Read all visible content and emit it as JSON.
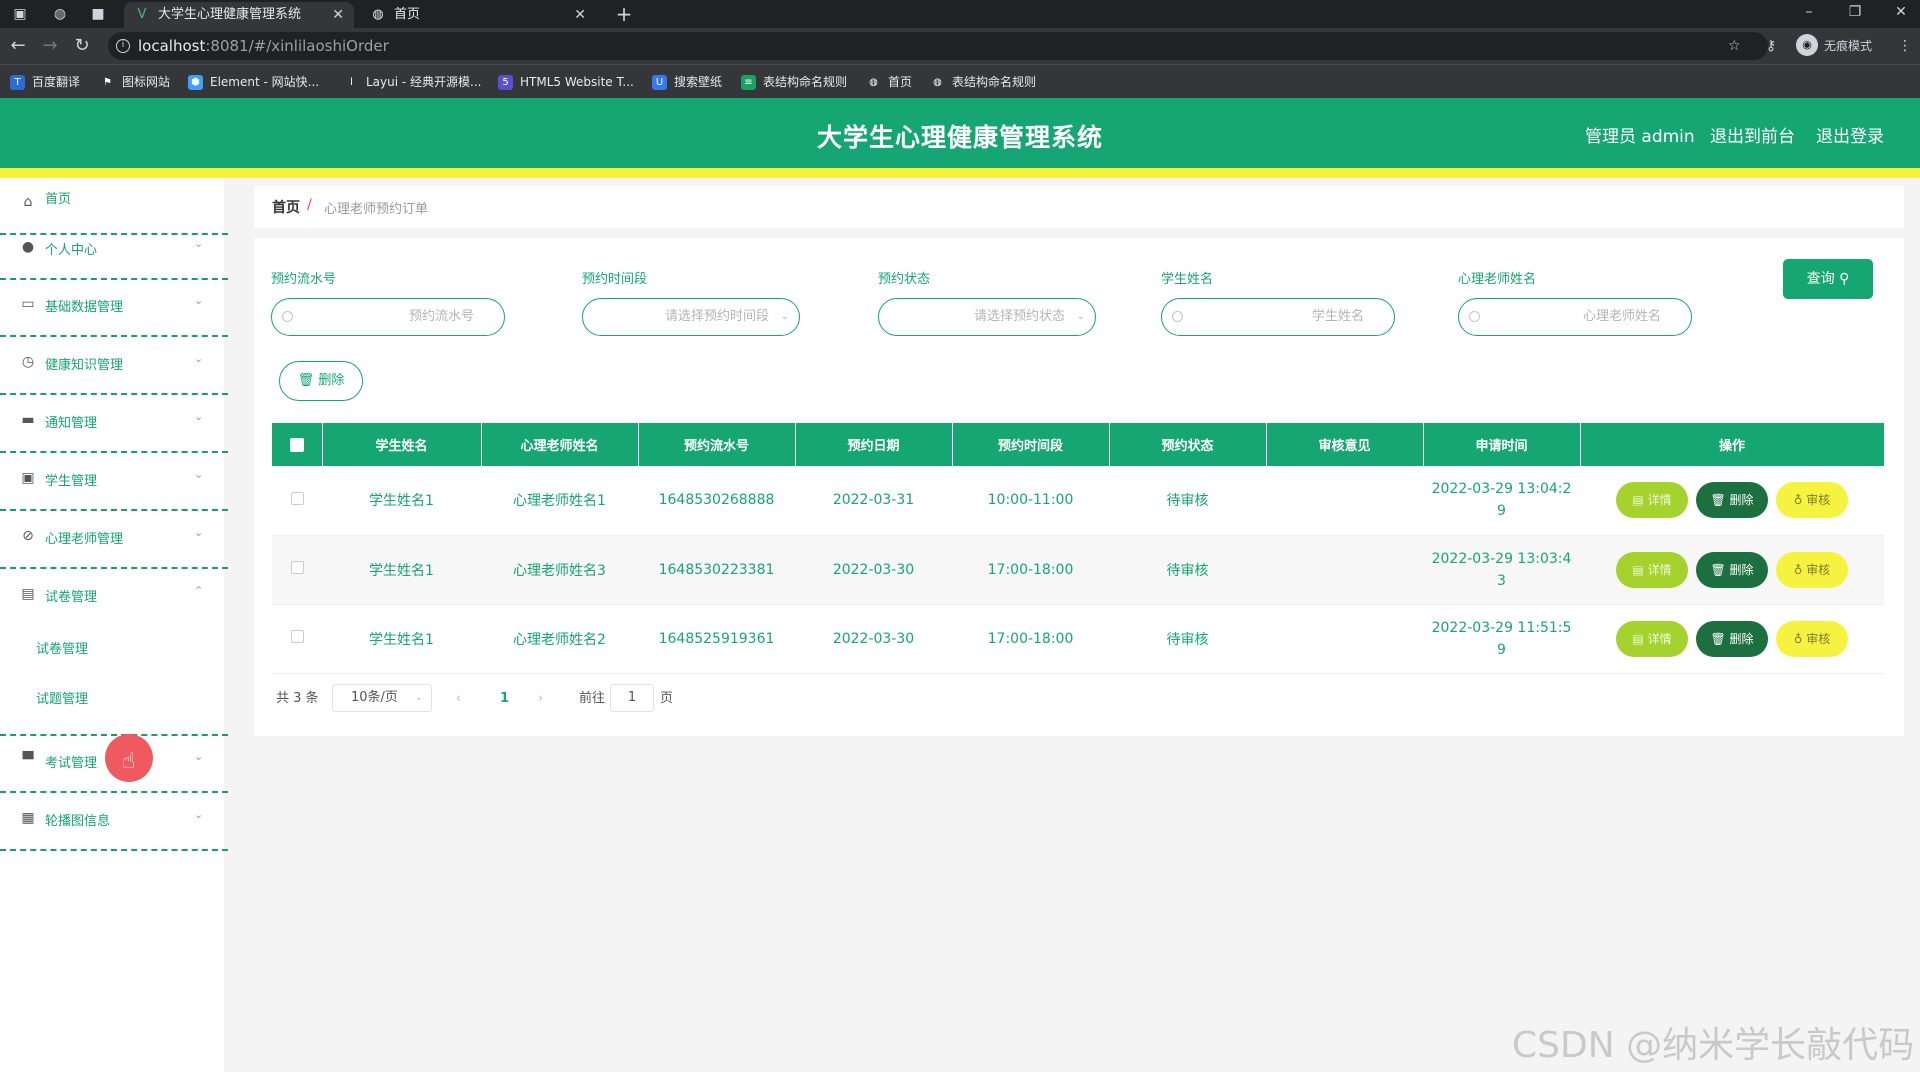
{
  "browser": {
    "tabs": [
      {
        "title": "大学生心理健康管理系统",
        "favicon": "vue-icon"
      },
      {
        "title": "首页",
        "favicon": "globe-icon"
      }
    ],
    "url_host": "localhost",
    "url_path": ":8081/#/xinlilaoshiOrder",
    "incognito_label": "无痕模式",
    "bookmarks": [
      "百度翻译",
      "图标网站",
      "Element - 网站快...",
      "Layui - 经典开源模...",
      "HTML5 Website T...",
      "搜索壁纸",
      "表结构命名规则",
      "首页",
      "表结构命名规则"
    ]
  },
  "header": {
    "title": "大学生心理健康管理系统",
    "admin": "管理员 admin",
    "to_front": "退出到前台",
    "logout": "退出登录",
    "brand_color": "#15a672",
    "accent_color": "#f4f33c"
  },
  "sidebar": {
    "items": [
      {
        "label": "首页",
        "icon": "home-icon"
      },
      {
        "label": "个人中心",
        "icon": "user-icon"
      },
      {
        "label": "基础数据管理",
        "icon": "chat-icon"
      },
      {
        "label": "健康知识管理",
        "icon": "clock-icon"
      },
      {
        "label": "通知管理",
        "icon": "briefcase-icon"
      },
      {
        "label": "学生管理",
        "icon": "monitor-icon"
      },
      {
        "label": "心理老师管理",
        "icon": "compass-icon"
      },
      {
        "label": "试卷管理",
        "icon": "clipboard-icon"
      },
      {
        "label": "考试管理",
        "icon": "screen-icon"
      },
      {
        "label": "轮播图信息",
        "icon": "grid-icon"
      }
    ],
    "sub_items": [
      "试卷管理",
      "试题管理"
    ]
  },
  "breadcrumb": {
    "home": "首页",
    "sep": "/",
    "current": "心理老师预约订单"
  },
  "filters": [
    {
      "label": "预约流水号",
      "placeholder": "预约流水号"
    },
    {
      "label": "预约时间段",
      "placeholder": "请选择预约时间段"
    },
    {
      "label": "预约状态",
      "placeholder": "请选择预约状态"
    },
    {
      "label": "学生姓名",
      "placeholder": "学生姓名"
    },
    {
      "label": "心理老师姓名",
      "placeholder": "心理老师姓名"
    }
  ],
  "buttons": {
    "search": "查询",
    "delete": "删除",
    "detail": "详情",
    "remove": "删除",
    "audit": "审核"
  },
  "table": {
    "columns": [
      "学生姓名",
      "心理老师姓名",
      "预约流水号",
      "预约日期",
      "预约时间段",
      "预约状态",
      "审核意见",
      "申请时间",
      "操作"
    ],
    "rows": [
      {
        "student": "学生姓名1",
        "teacher": "心理老师姓名1",
        "serial": "1648530268888",
        "date": "2022-03-31",
        "slot": "10:00-11:00",
        "status": "待审核",
        "opinion": "",
        "apply1": "2022-03-29 13:04:2",
        "apply2": "9"
      },
      {
        "student": "学生姓名1",
        "teacher": "心理老师姓名3",
        "serial": "1648530223381",
        "date": "2022-03-30",
        "slot": "17:00-18:00",
        "status": "待审核",
        "opinion": "",
        "apply1": "2022-03-29 13:03:4",
        "apply2": "3"
      },
      {
        "student": "学生姓名1",
        "teacher": "心理老师姓名2",
        "serial": "1648525919361",
        "date": "2022-03-30",
        "slot": "17:00-18:00",
        "status": "待审核",
        "opinion": "",
        "apply1": "2022-03-29 11:51:5",
        "apply2": "9"
      }
    ]
  },
  "pagination": {
    "total": "共 3 条",
    "page_size": "10条/页",
    "current": "1",
    "goto": "前往",
    "goto_value": "1",
    "unit": "页"
  },
  "watermark": "CSDN @纳米学长敲代码"
}
